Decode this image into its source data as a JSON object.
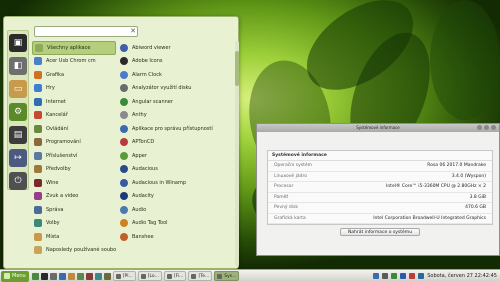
{
  "colors": {
    "menu_bg": "#e9f1d3",
    "accent": "#6c9e2d",
    "selected": "#b5ce7c"
  },
  "favorites": [
    {
      "icon": "terminal-icon",
      "color": "#2b2b2b"
    },
    {
      "icon": "settings-icon",
      "color": "#6e6e6e"
    },
    {
      "icon": "folder-icon",
      "color": "#c89a4b"
    },
    {
      "icon": "gear-icon",
      "color": "#5b8a2a"
    },
    {
      "icon": "lock-icon",
      "color": "#3c3c3c"
    },
    {
      "icon": "logout-icon",
      "color": "#4a5a80"
    },
    {
      "icon": "power-icon",
      "color": "#505050"
    }
  ],
  "search": {
    "value": "",
    "placeholder": ""
  },
  "categories": [
    {
      "label": "Všechny aplikace",
      "color": "#8da95a"
    },
    {
      "label": "Acer Usb Chrom cm",
      "color": "#4a80c8"
    },
    {
      "label": "Grafika",
      "color": "#d07020"
    },
    {
      "label": "Hry",
      "color": "#3e7fd1"
    },
    {
      "label": "Internet",
      "color": "#2e6fb0"
    },
    {
      "label": "Kancelář",
      "color": "#c44b2e"
    },
    {
      "label": "Ovládání",
      "color": "#6a8a3a"
    },
    {
      "label": "Programování",
      "color": "#8a6a3a"
    },
    {
      "label": "Příslušenství",
      "color": "#5a7aa0"
    },
    {
      "label": "Předvolby",
      "color": "#9b7a3a"
    },
    {
      "label": "Wine",
      "color": "#7a2a2a"
    },
    {
      "label": "Zvuk a video",
      "color": "#9a3a8a"
    },
    {
      "label": "Správa",
      "color": "#4a6a9a"
    },
    {
      "label": "Volby",
      "color": "#3a8a7a"
    },
    {
      "label": "Místa",
      "color": "#c89a4b"
    },
    {
      "label": "Naposledy používané soubory",
      "color": "#c8a45b"
    }
  ],
  "apps": [
    {
      "label": "Abiword viewer",
      "color": "#3e5fa8"
    },
    {
      "label": "Adobe Icons",
      "color": "#2a2a2a"
    },
    {
      "label": "Alarm Clock",
      "color": "#4a7ac8"
    },
    {
      "label": "Analyzátor využití disku",
      "color": "#6a6a6a"
    },
    {
      "label": "Angular scanner",
      "color": "#3a8a3a"
    },
    {
      "label": "Anthy",
      "color": "#8a8a8a"
    },
    {
      "label": "Aplikace pro správu přístupností",
      "color": "#3a6ab0"
    },
    {
      "label": "APTonCD",
      "color": "#b83a3a"
    },
    {
      "label": "Apper",
      "color": "#5a9a3a"
    },
    {
      "label": "Audacious",
      "color": "#2a4a8a"
    },
    {
      "label": "Audacious in Winamp",
      "color": "#3a5aa0"
    },
    {
      "label": "Audacity",
      "color": "#1a3a7a"
    },
    {
      "label": "Audio",
      "color": "#4a7ab0"
    },
    {
      "label": "Audio Tag Tool",
      "color": "#d08020"
    },
    {
      "label": "Banshee",
      "color": "#c0602a"
    }
  ],
  "window": {
    "title": "Systémové informace",
    "section": "Systémové informace",
    "rows": [
      {
        "k": "Operační systém",
        "v": "Rosa 06 2017.0 Mandrake"
      },
      {
        "k": "Linuxové jádro",
        "v": "3.4.0 (Wyspon)"
      },
      {
        "k": "Procesor",
        "v": "Intel® Core™ i5-3360M CPU @ 2.80GHz × 2"
      },
      {
        "k": "Paměť",
        "v": "3.8 GiB"
      },
      {
        "k": "Pevný disk",
        "v": "470.6 GB"
      },
      {
        "k": "Grafická karta",
        "v": "Intel Corporation Broadwell-U Integrated Graphics"
      }
    ],
    "upload_label": "Nahrát informace o systému"
  },
  "taskbar": {
    "menu_label": "Menu",
    "quick_icons": [
      {
        "icon": "files-icon",
        "color": "#4a8a3a"
      },
      {
        "icon": "terminal-icon",
        "color": "#2a2a2a"
      },
      {
        "icon": "settings-icon",
        "color": "#6a6a6a"
      },
      {
        "icon": "globe-icon",
        "color": "#3a6ab0"
      },
      {
        "icon": "mail-icon",
        "color": "#c08a3a"
      },
      {
        "icon": "media-icon",
        "color": "#5a8a4a"
      },
      {
        "icon": "app-icon",
        "color": "#8a3a3a"
      },
      {
        "icon": "app-icon",
        "color": "#3a8a8a"
      },
      {
        "icon": "app-icon",
        "color": "#6a6a3a"
      }
    ],
    "tasks": [
      {
        "label": "[Pl...",
        "active": false
      },
      {
        "label": "[Lo...",
        "active": false
      },
      {
        "label": "[Fi...",
        "active": false
      },
      {
        "label": "[Te...",
        "active": false
      },
      {
        "label": "Sys...",
        "active": true
      }
    ],
    "tray_icons": [
      {
        "icon": "network-icon",
        "color": "#3a6ab0"
      },
      {
        "icon": "volume-icon",
        "color": "#5a5a5a"
      },
      {
        "icon": "battery-icon",
        "color": "#3a8a3a"
      },
      {
        "icon": "bluetooth-icon",
        "color": "#2a5ab0"
      },
      {
        "icon": "update-icon",
        "color": "#c03a3a"
      },
      {
        "icon": "wordpress-icon",
        "color": "#2a6a9a"
      }
    ],
    "clock": "Sobota, červen 27 22:42:45"
  }
}
